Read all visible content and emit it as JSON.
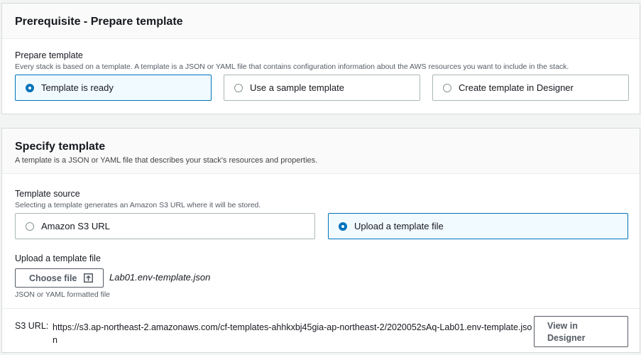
{
  "prerequisite": {
    "title": "Prerequisite - Prepare template",
    "field_label": "Prepare template",
    "field_description": "Every stack is based on a template. A template is a JSON or YAML file that contains configuration information about the AWS resources you want to include in the stack.",
    "options": [
      {
        "label": "Template is ready",
        "selected": true
      },
      {
        "label": "Use a sample template",
        "selected": false
      },
      {
        "label": "Create template in Designer",
        "selected": false
      }
    ]
  },
  "specify": {
    "title": "Specify template",
    "description": "A template is a JSON or YAML file that describes your stack's resources and properties.",
    "source_label": "Template source",
    "source_description": "Selecting a template generates an Amazon S3 URL where it will be stored.",
    "source_options": [
      {
        "label": "Amazon S3 URL",
        "selected": false
      },
      {
        "label": "Upload a template file",
        "selected": true
      }
    ],
    "upload_label": "Upload a template file",
    "choose_file_label": "Choose file",
    "upload_icon": "upload-icon",
    "file_name": "Lab01.env-template.json",
    "upload_hint": "JSON or YAML formatted file",
    "s3_label": "S3 URL:",
    "s3_url": "https://s3.ap-northeast-2.amazonaws.com/cf-templates-ahhkxbj45gia-ap-northeast-2/2020052sAq-Lab01.env-template.json",
    "view_designer_label": "View in Designer"
  },
  "colors": {
    "accent": "#0073bb",
    "selected_bg": "#f1faff",
    "border": "#aab7b8"
  }
}
